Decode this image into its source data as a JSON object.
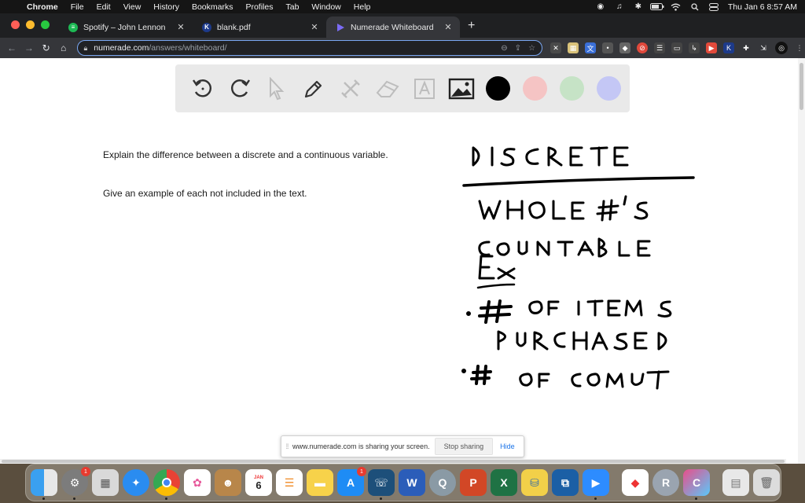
{
  "menubar": {
    "app": "Chrome",
    "items": [
      "File",
      "Edit",
      "View",
      "History",
      "Bookmarks",
      "Profiles",
      "Tab",
      "Window",
      "Help"
    ],
    "clock": "Thu Jan 6  8:57 AM"
  },
  "tabs": [
    {
      "title": "Spotify – John Lennon",
      "icon": "spotify-icon",
      "color": "#1db954",
      "active": false
    },
    {
      "title": "blank.pdf",
      "icon": "kami-icon",
      "color": "#1d3a8a",
      "active": false
    },
    {
      "title": "Numerade Whiteboard",
      "icon": "numerade-icon",
      "color": "#6f5cf5",
      "active": true
    }
  ],
  "omnibox": {
    "host": "numerade.com",
    "path": "/answers/whiteboard/"
  },
  "whiteboard": {
    "tools": [
      "undo-icon",
      "redo-icon",
      "pointer-icon",
      "pen-icon",
      "tools-icon",
      "eraser-icon",
      "text-icon",
      "image-icon"
    ],
    "colors": [
      "#000000",
      "#f5c4c4",
      "#c6e3c6",
      "#c4c7f5"
    ]
  },
  "question": {
    "line1": "Explain the difference between a discrete and a continuous variable.",
    "line2": "Give an example of each not included in the text."
  },
  "share": {
    "message": "www.numerade.com is sharing your screen.",
    "stop": "Stop sharing",
    "hide": "Hide"
  },
  "dock": {
    "calendar_month": "JAN",
    "calendar_day": "6",
    "badges": {
      "system-preferences": "1",
      "app-store": "1"
    }
  }
}
